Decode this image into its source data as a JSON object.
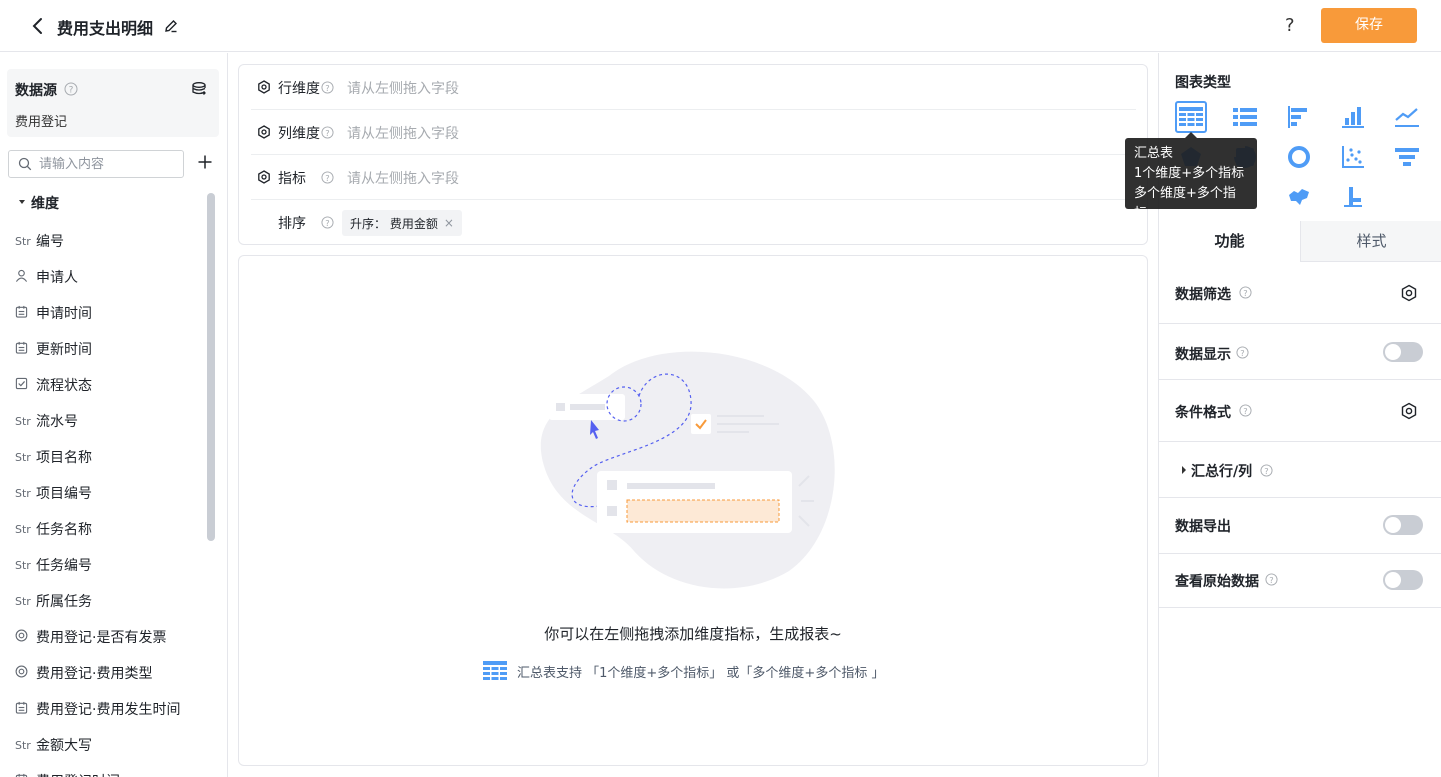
{
  "header": {
    "title": "费用支出明细",
    "help": "?",
    "save_label": "保存"
  },
  "datasource": {
    "title": "数据源",
    "name": "费用登记"
  },
  "search": {
    "placeholder": "请输入内容"
  },
  "dimensions": {
    "header": "维度",
    "fields": [
      {
        "type": "Str",
        "label": "编号"
      },
      {
        "type": "user-icon",
        "label": "申请人"
      },
      {
        "type": "calendar-icon",
        "label": "申请时间"
      },
      {
        "type": "calendar-icon",
        "label": "更新时间"
      },
      {
        "type": "check-icon",
        "label": "流程状态"
      },
      {
        "type": "Str",
        "label": "流水号"
      },
      {
        "type": "Str",
        "label": "项目名称"
      },
      {
        "type": "Str",
        "label": "项目编号"
      },
      {
        "type": "Str",
        "label": "任务名称"
      },
      {
        "type": "Str",
        "label": "任务编号"
      },
      {
        "type": "Str",
        "label": "所属任务"
      },
      {
        "type": "radio-icon",
        "label": "费用登记·是否有发票"
      },
      {
        "type": "radio-icon",
        "label": "费用登记·费用类型"
      },
      {
        "type": "calendar-icon",
        "label": "费用登记·费用发生时间"
      },
      {
        "type": "Str",
        "label": "金额大写"
      },
      {
        "type": "calendar-icon",
        "label": "费用登记时间"
      }
    ]
  },
  "config": {
    "row_dim": {
      "label": "行维度",
      "placeholder": "请从左侧拖入字段"
    },
    "col_dim": {
      "label": "列维度",
      "placeholder": "请从左侧拖入字段"
    },
    "metric": {
      "label": "指标",
      "placeholder": "请从左侧拖入字段"
    },
    "sort": {
      "label": "排序",
      "tag": "升序：  费用金额",
      "tag_close": "×"
    }
  },
  "canvas": {
    "empty_title": "你可以在左侧拖拽添加维度指标，生成报表~",
    "empty_hint": "汇总表支持 「1个维度+多个指标」 或「多个维度+多个指标 」"
  },
  "chart_types": {
    "title": "图表类型",
    "selected": "summary-table",
    "tooltip": {
      "title": "汇总表",
      "line1": "1个维度+多个指标",
      "line2": "多个维度+多个指标"
    }
  },
  "tabs": {
    "function": "功能",
    "style": "样式"
  },
  "options": [
    {
      "label": "数据筛选",
      "control": "gear"
    },
    {
      "label": "数据显示",
      "control": "toggle",
      "value": false
    },
    {
      "label": "条件格式",
      "control": "gear"
    },
    {
      "label": "汇总行/列",
      "control": "expand"
    },
    {
      "label": "数据导出",
      "control": "toggle",
      "value": false
    },
    {
      "label": "查看原始数据",
      "control": "toggle",
      "value": false
    }
  ],
  "colors": {
    "accent": "#f89a3a",
    "chart_icon": "#4f9cf6"
  }
}
